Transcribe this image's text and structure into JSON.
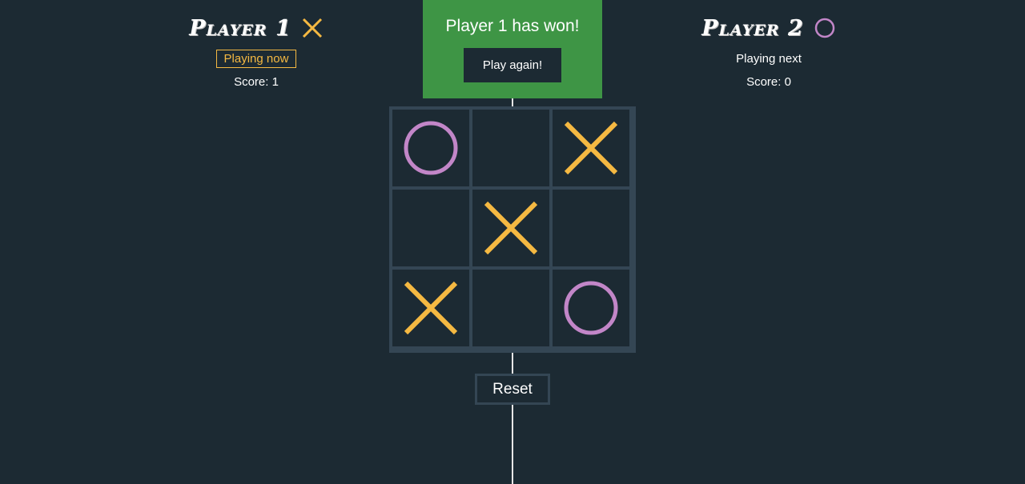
{
  "players": [
    {
      "name": "Player 1",
      "mark": "x-icon",
      "status": "Playing now",
      "score": "Score: 1",
      "active": true
    },
    {
      "name": "Player 2",
      "mark": "o-icon",
      "status": "Playing next",
      "score": "Score: 0",
      "active": false
    }
  ],
  "banner": {
    "message": "Player 1 has won!",
    "play_again_label": "Play again!"
  },
  "board": {
    "cells": [
      "O",
      "",
      "X",
      "",
      "X",
      "",
      "X",
      "",
      "O"
    ]
  },
  "reset_label": "Reset",
  "colors": {
    "background": "#1c2a33",
    "grid": "#344654",
    "x": "#f5b942",
    "o": "#c286c8",
    "win": "#3e9545"
  }
}
